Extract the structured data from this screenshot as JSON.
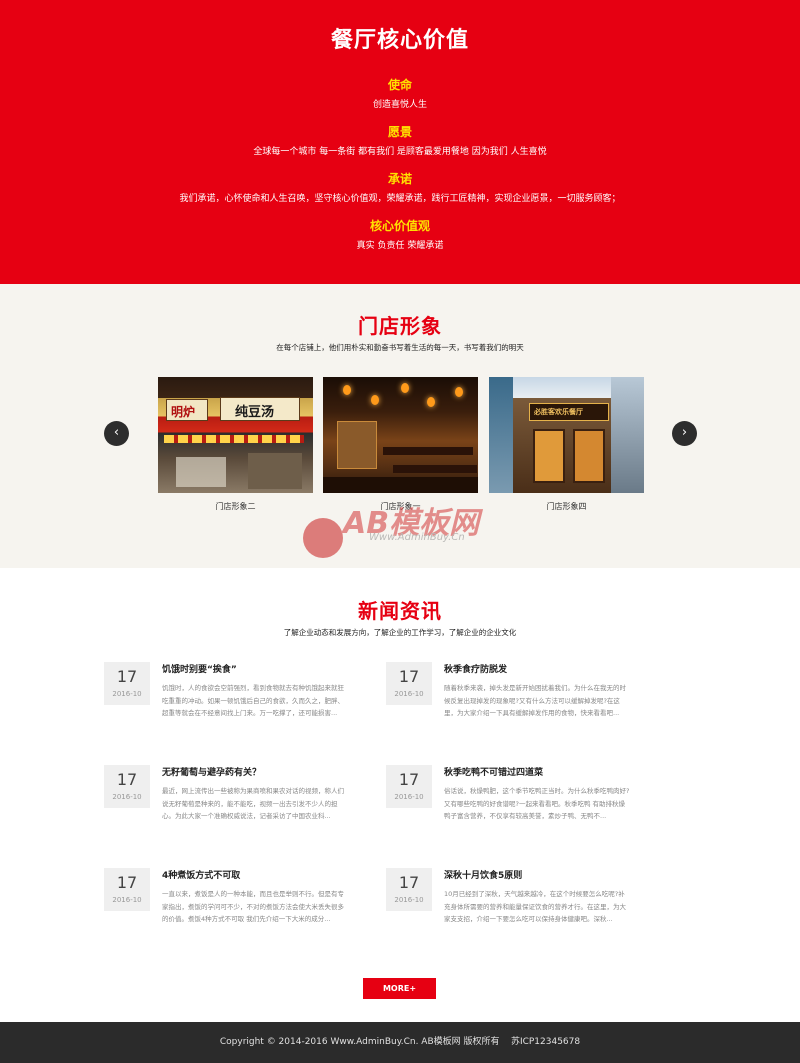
{
  "core_values": {
    "heading": "餐厅核心价值",
    "items": [
      {
        "title": "使命",
        "text": "创造喜悦人生"
      },
      {
        "title": "愿景",
        "text": "全球每一个城市 每一条街 都有我们 是顾客最爱用餐地 因为我们 人生喜悦"
      },
      {
        "title": "承诺",
        "text": "我们承诺，心怀使命和人生召唤，坚守核心价值观，荣耀承诺，践行工匠精神，实现企业愿景，一切服务顾客；"
      },
      {
        "title": "核心价值观",
        "text": "真实 负责任 荣耀承诺"
      }
    ]
  },
  "stores": {
    "heading": "门店形象",
    "subtitle": "在每个店铺上，他们用朴实和勤奋书写着生活的每一天，书写着我们的明天",
    "items": [
      {
        "caption": "门店形象二",
        "sign": "明炉",
        "sign2": "纯豆汤"
      },
      {
        "caption": "门店形象一"
      },
      {
        "caption": "门店形象四",
        "sign": "必胜客欢乐餐厅"
      }
    ],
    "prev_icon": "chevron-left-icon",
    "next_icon": "chevron-right-icon"
  },
  "watermark": {
    "text": "AB模板网",
    "url": "Www.AdminBuy.Cn"
  },
  "news": {
    "heading": "新闻资讯",
    "subtitle": "了解企业动态和发展方向，了解企业的工作学习，了解企业的企业文化",
    "items": [
      {
        "day": "17",
        "ym": "2016-10",
        "title": "饥饿时别要“挨食”",
        "desc": "饥饿时，人的食欲会空前强烈，看到食物就去有种饥饿起来就狂吃重重的冲动。如果一顿饥饿后自己的食欲，久而久之，肥胖、超重等就会在不经意间找上门来。万一吃撑了，还可能损害..."
      },
      {
        "day": "17",
        "ym": "2016-10",
        "title": "秋季食疗防脱发",
        "desc": "随着秋季来袭，掉头发是新开始困扰着我们。为什么在我无的时候反复出现掉发的现象呢?又有什么方法可以缓解掉发呢?在这里，为大家介绍一下具有缓解掉发作用的食物，快来看看吧..."
      },
      {
        "day": "17",
        "ym": "2016-10",
        "title": "无籽葡萄与避孕药有关？",
        "desc": "最近，网上流传出一些被称为果商喷和果农对话的视频，称人们说无籽葡萄是种来的，能不能吃，视频一出去引发不少人的担心。为此大家一个准确权威说法，记者采访了中国农业科..."
      },
      {
        "day": "17",
        "ym": "2016-10",
        "title": "秋季吃鸭不可错过四道菜",
        "desc": "俗话说，秋燥鸭肥，这个季节吃鸭正当时。为什么秋季吃鸭肉好?又有哪些吃鸭的好食谱呢?一起来看看吧。秋季吃鸭 有助排秋燥 鸭子富含营养，不仅享有较高美誉，素炒子鸭、无鸭不..."
      },
      {
        "day": "17",
        "ym": "2016-10",
        "title": "4种煮饭方式不可取",
        "desc": "一直以来，煮饭是人的一种本能，而且也是举则不行。但是有专家指出，煮饭的学问可不少，不对的煮饭方法会使大米丢失很多的价值。煮饭4种方式不可取 我们先介绍一下大米的成分..."
      },
      {
        "day": "17",
        "ym": "2016-10",
        "title": "深秋十月饮食5原则",
        "desc": "10月已经到了深秋，天气越来越冷，在这个时候要怎么吃呢?补充身体所需要的营养和能量保证饮食的营养才行。在这里，为大家支支招，介绍一下要怎么吃可以保持身体健康吧。深秋..."
      }
    ],
    "more_label": "MORE+"
  },
  "footer": {
    "text": "Copyright © 2014-2016 Www.AdminBuy.Cn. AB模板网 版权所有    苏ICP12345678"
  }
}
